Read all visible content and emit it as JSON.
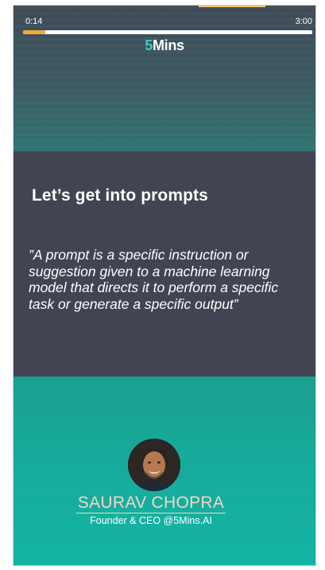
{
  "player": {
    "current_time": "0:14",
    "total_time": "3:00",
    "progress_fraction": 0.078
  },
  "brand": {
    "number": "5",
    "word": "Mins"
  },
  "slide": {
    "headline": "Let’s get into prompts",
    "quote": "”A prompt is a specific instruction or suggestion given to a machine learning model that directs it to perform a specific task or generate a specific output”"
  },
  "speaker": {
    "name": "SAURAV CHOPRA",
    "role": "Founder & CEO @5Mins.AI"
  },
  "colors": {
    "progress_fill": "#f2a93b",
    "brand_accent": "#36d1c1",
    "mid_band": "#414552",
    "bottom_band": "#16ac9c",
    "speaker_name": "#f3d6c2"
  }
}
